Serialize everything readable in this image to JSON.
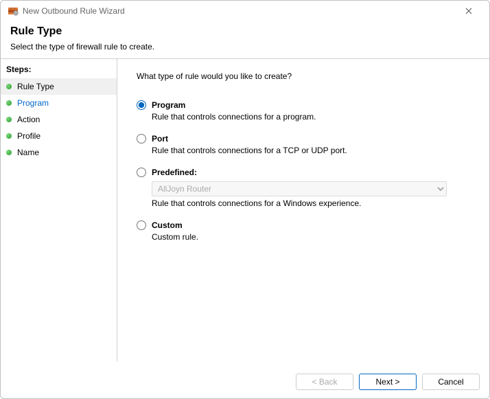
{
  "window": {
    "title": "New Outbound Rule Wizard"
  },
  "header": {
    "title": "Rule Type",
    "subheading": "Select the type of firewall rule to create."
  },
  "sidebar": {
    "label": "Steps:",
    "items": [
      {
        "label": "Rule Type",
        "current": true,
        "link": false
      },
      {
        "label": "Program",
        "current": false,
        "link": true
      },
      {
        "label": "Action",
        "current": false,
        "link": false
      },
      {
        "label": "Profile",
        "current": false,
        "link": false
      },
      {
        "label": "Name",
        "current": false,
        "link": false
      }
    ]
  },
  "content": {
    "prompt": "What type of rule would you like to create?",
    "options": [
      {
        "id": "program",
        "label": "Program",
        "desc": "Rule that controls connections for a program.",
        "checked": true
      },
      {
        "id": "port",
        "label": "Port",
        "desc": "Rule that controls connections for a TCP or UDP port.",
        "checked": false
      },
      {
        "id": "predefined",
        "label": "Predefined:",
        "desc": "Rule that controls connections for a Windows experience.",
        "checked": false,
        "select_value": "AllJoyn Router",
        "select_disabled": true
      },
      {
        "id": "custom",
        "label": "Custom",
        "desc": "Custom rule.",
        "checked": false
      }
    ]
  },
  "footer": {
    "back": "< Back",
    "next": "Next >",
    "cancel": "Cancel",
    "back_disabled": true
  }
}
